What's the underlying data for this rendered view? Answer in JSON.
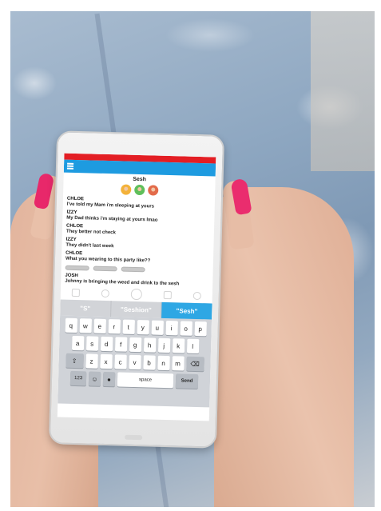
{
  "chat": {
    "title": "Sesh",
    "messages": [
      {
        "name": "CHLOE",
        "text": "I've told my Mam i'm sleeping at yours"
      },
      {
        "name": "IZZY",
        "text": "My Dad thinks i'm staying at yours lmao"
      },
      {
        "name": "CHLOE",
        "text": "They better not check"
      },
      {
        "name": "IZZY",
        "text": "They didn't last week"
      },
      {
        "name": "CHLOE",
        "text": "What you wearing to this party like??"
      },
      {
        "name": "JOSH",
        "text": "Johnny is bringing the weed and drink to the sesh"
      }
    ]
  },
  "suggestions": [
    "\"S\"",
    "\"Seshion\"",
    "\"Sesh\""
  ],
  "keyboard": {
    "row1": [
      "q",
      "w",
      "e",
      "r",
      "t",
      "y",
      "u",
      "i",
      "o",
      "p"
    ],
    "row2": [
      "a",
      "s",
      "d",
      "f",
      "g",
      "h",
      "j",
      "k",
      "l"
    ],
    "row3": [
      "z",
      "x",
      "c",
      "v",
      "b",
      "n",
      "m"
    ],
    "shift": "⇧",
    "backspace": "⌫",
    "numbers": "123",
    "space": "space",
    "send": "Send"
  },
  "colors": {
    "status_bar": "#e31e24",
    "app_bar": "#1e9be0",
    "active_suggestion": "#2ea7e4",
    "nail_polish": "#e8286a"
  },
  "icons": [
    "menu-icon",
    "attachment-icon",
    "phone-icon",
    "camera-icon",
    "video-icon",
    "location-icon",
    "shift-icon",
    "backspace-icon",
    "emoji-icon",
    "mic-icon"
  ]
}
